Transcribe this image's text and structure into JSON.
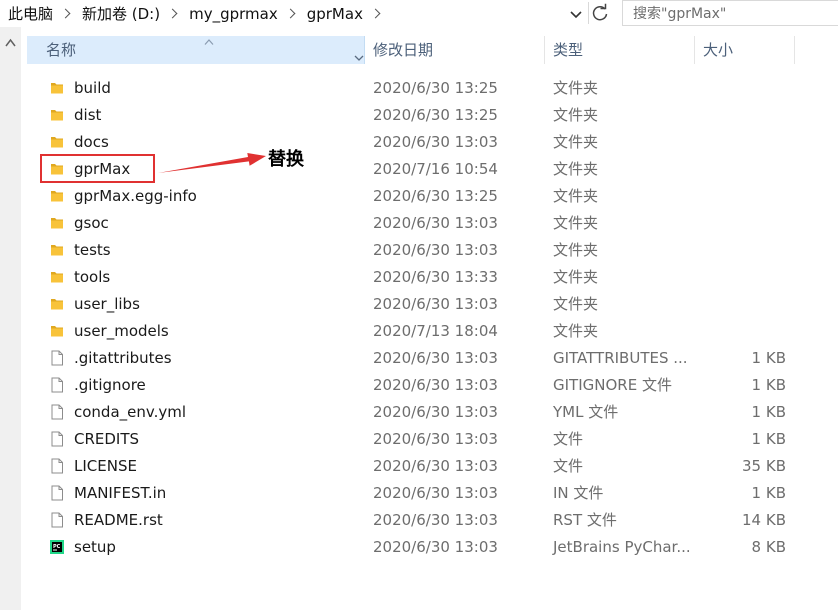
{
  "breadcrumb": [
    "此电脑",
    "新加卷 (D:)",
    "my_gprmax",
    "gprMax"
  ],
  "search": {
    "placeholder": "搜索\"gprMax\""
  },
  "columns": {
    "name": "名称",
    "date": "修改日期",
    "type": "类型",
    "size": "大小"
  },
  "files": [
    {
      "name": "build",
      "date": "2020/6/30 13:25",
      "type": "文件夹",
      "size": "",
      "icon": "folder-icon"
    },
    {
      "name": "dist",
      "date": "2020/6/30 13:25",
      "type": "文件夹",
      "size": "",
      "icon": "folder-icon"
    },
    {
      "name": "docs",
      "date": "2020/6/30 13:03",
      "type": "文件夹",
      "size": "",
      "icon": "folder-icon"
    },
    {
      "name": "gprMax",
      "date": "2020/7/16 10:54",
      "type": "文件夹",
      "size": "",
      "icon": "folder-icon"
    },
    {
      "name": "gprMax.egg-info",
      "date": "2020/6/30 13:25",
      "type": "文件夹",
      "size": "",
      "icon": "folder-icon"
    },
    {
      "name": "gsoc",
      "date": "2020/6/30 13:03",
      "type": "文件夹",
      "size": "",
      "icon": "folder-icon"
    },
    {
      "name": "tests",
      "date": "2020/6/30 13:03",
      "type": "文件夹",
      "size": "",
      "icon": "folder-icon"
    },
    {
      "name": "tools",
      "date": "2020/6/30 13:33",
      "type": "文件夹",
      "size": "",
      "icon": "folder-icon"
    },
    {
      "name": "user_libs",
      "date": "2020/6/30 13:03",
      "type": "文件夹",
      "size": "",
      "icon": "folder-icon"
    },
    {
      "name": "user_models",
      "date": "2020/7/13 18:04",
      "type": "文件夹",
      "size": "",
      "icon": "folder-icon"
    },
    {
      "name": ".gitattributes",
      "date": "2020/6/30 13:03",
      "type": "GITATTRIBUTES ...",
      "size": "1 KB",
      "icon": "file-icon"
    },
    {
      "name": ".gitignore",
      "date": "2020/6/30 13:03",
      "type": "GITIGNORE 文件",
      "size": "1 KB",
      "icon": "file-icon"
    },
    {
      "name": "conda_env.yml",
      "date": "2020/6/30 13:03",
      "type": "YML 文件",
      "size": "1 KB",
      "icon": "file-icon"
    },
    {
      "name": "CREDITS",
      "date": "2020/6/30 13:03",
      "type": "文件",
      "size": "1 KB",
      "icon": "file-icon"
    },
    {
      "name": "LICENSE",
      "date": "2020/6/30 13:03",
      "type": "文件",
      "size": "35 KB",
      "icon": "file-icon"
    },
    {
      "name": "MANIFEST.in",
      "date": "2020/6/30 13:03",
      "type": "IN 文件",
      "size": "1 KB",
      "icon": "file-icon"
    },
    {
      "name": "README.rst",
      "date": "2020/6/30 13:03",
      "type": "RST 文件",
      "size": "14 KB",
      "icon": "file-icon"
    },
    {
      "name": "setup",
      "date": "2020/6/30 13:03",
      "type": "JetBrains PyChar...",
      "size": "8 KB",
      "icon": "pycharm-file-icon"
    }
  ],
  "annotation": {
    "text": "替换",
    "color": "#e03131"
  },
  "colors": {
    "folder": "#f8c33a",
    "header_selected": "#dcecfc",
    "header_text": "#4c607a",
    "annotation": "#e03131"
  }
}
